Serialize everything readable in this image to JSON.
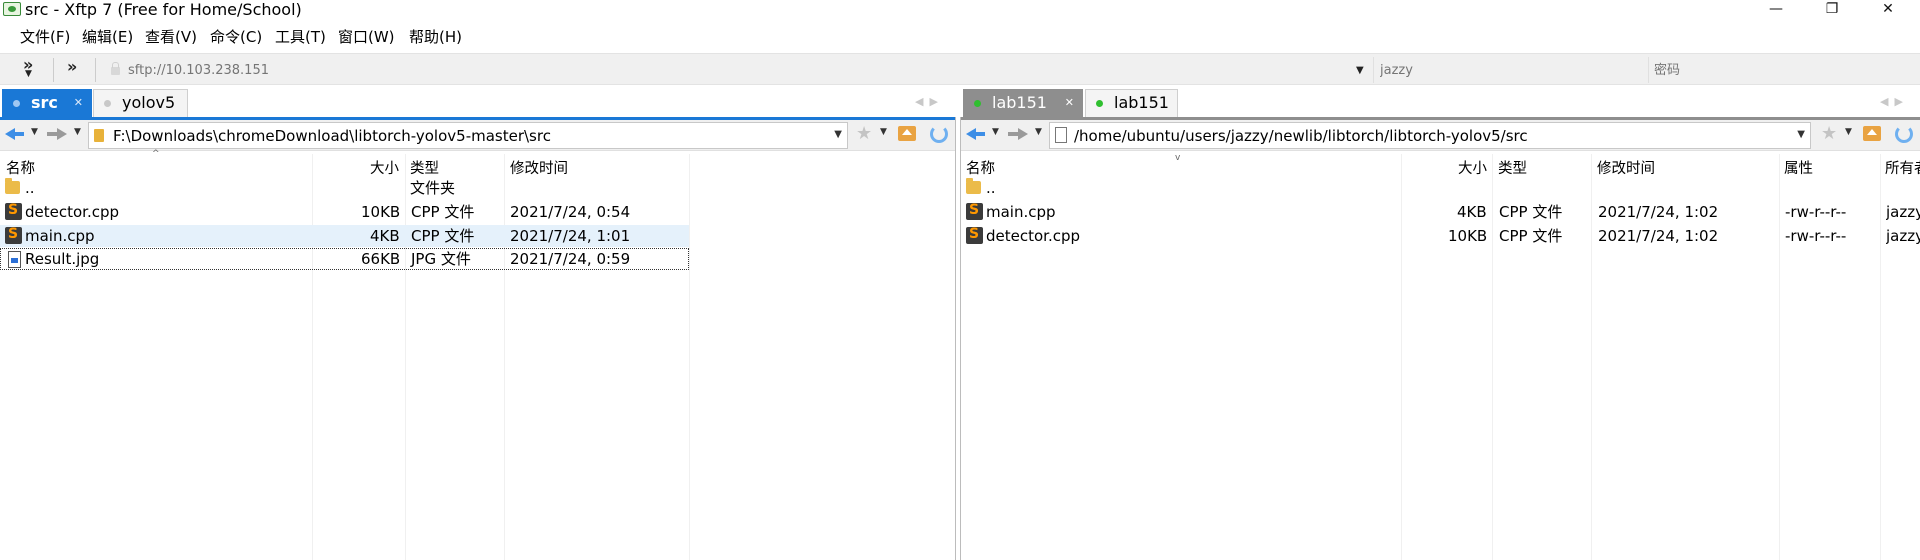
{
  "window": {
    "title": "src - Xftp 7 (Free for Home/School)",
    "minimize_glyph": "—",
    "maximize_glyph": "❐",
    "close_glyph": "✕"
  },
  "menu": [
    "文件(F)",
    "编辑(E)",
    "查看(V)",
    "命令(C)",
    "工具(T)",
    "窗口(W)",
    "帮助(H)"
  ],
  "connection": {
    "host_placeholder": "sftp://10.103.238.151",
    "username_placeholder": "jazzy",
    "password_placeholder": "密码"
  },
  "left_tabs": [
    {
      "label": "src",
      "active": true,
      "dot_color": "#9fc7f2"
    },
    {
      "label": "yolov5",
      "active": false,
      "dot_color": "#c8c8c8"
    }
  ],
  "right_tabs": [
    {
      "label": "lab151",
      "active": true,
      "dot_color": "#2fbf2f"
    },
    {
      "label": "lab151",
      "active": false,
      "dot_color": "#2fbf2f"
    }
  ],
  "left_pane": {
    "path": "F:\\Downloads\\chromeDownload\\libtorch-yolov5-master\\src",
    "columns": {
      "name": "名称",
      "size": "大小",
      "type": "类型",
      "modified": "修改时间"
    },
    "files": [
      {
        "name": "..",
        "size": "",
        "type": "文件夹",
        "modified": "",
        "icon": "folder-icon"
      },
      {
        "name": "detector.cpp",
        "size": "10KB",
        "type": "CPP 文件",
        "modified": "2021/7/24, 0:54",
        "icon": "sublime-file-icon"
      },
      {
        "name": "main.cpp",
        "size": "4KB",
        "type": "CPP 文件",
        "modified": "2021/7/24, 1:01",
        "icon": "sublime-file-icon"
      },
      {
        "name": "Result.jpg",
        "size": "66KB",
        "type": "JPG 文件",
        "modified": "2021/7/24, 0:59",
        "icon": "image-file-icon"
      }
    ]
  },
  "right_pane": {
    "path": "/home/ubuntu/users/jazzy/newlib/libtorch/libtorch-yolov5/src",
    "columns": {
      "name": "名称",
      "size": "大小",
      "type": "类型",
      "modified": "修改时间",
      "attributes": "属性",
      "owner": "所有者"
    },
    "files": [
      {
        "name": "..",
        "size": "",
        "type": "",
        "modified": "",
        "attributes": "",
        "owner": "",
        "icon": "folder-icon"
      },
      {
        "name": "main.cpp",
        "size": "4KB",
        "type": "CPP 文件",
        "modified": "2021/7/24, 1:02",
        "attributes": "-rw-r--r--",
        "owner": "jazzy",
        "icon": "sublime-file-icon"
      },
      {
        "name": "detector.cpp",
        "size": "10KB",
        "type": "CPP 文件",
        "modified": "2021/7/24, 1:02",
        "attributes": "-rw-r--r--",
        "owner": "jazzy",
        "icon": "sublime-file-icon"
      }
    ]
  },
  "colors": {
    "accent_blue": "#1a78d6",
    "inactive_gray": "#8e8e8e",
    "selection": "#e5f1fb"
  }
}
